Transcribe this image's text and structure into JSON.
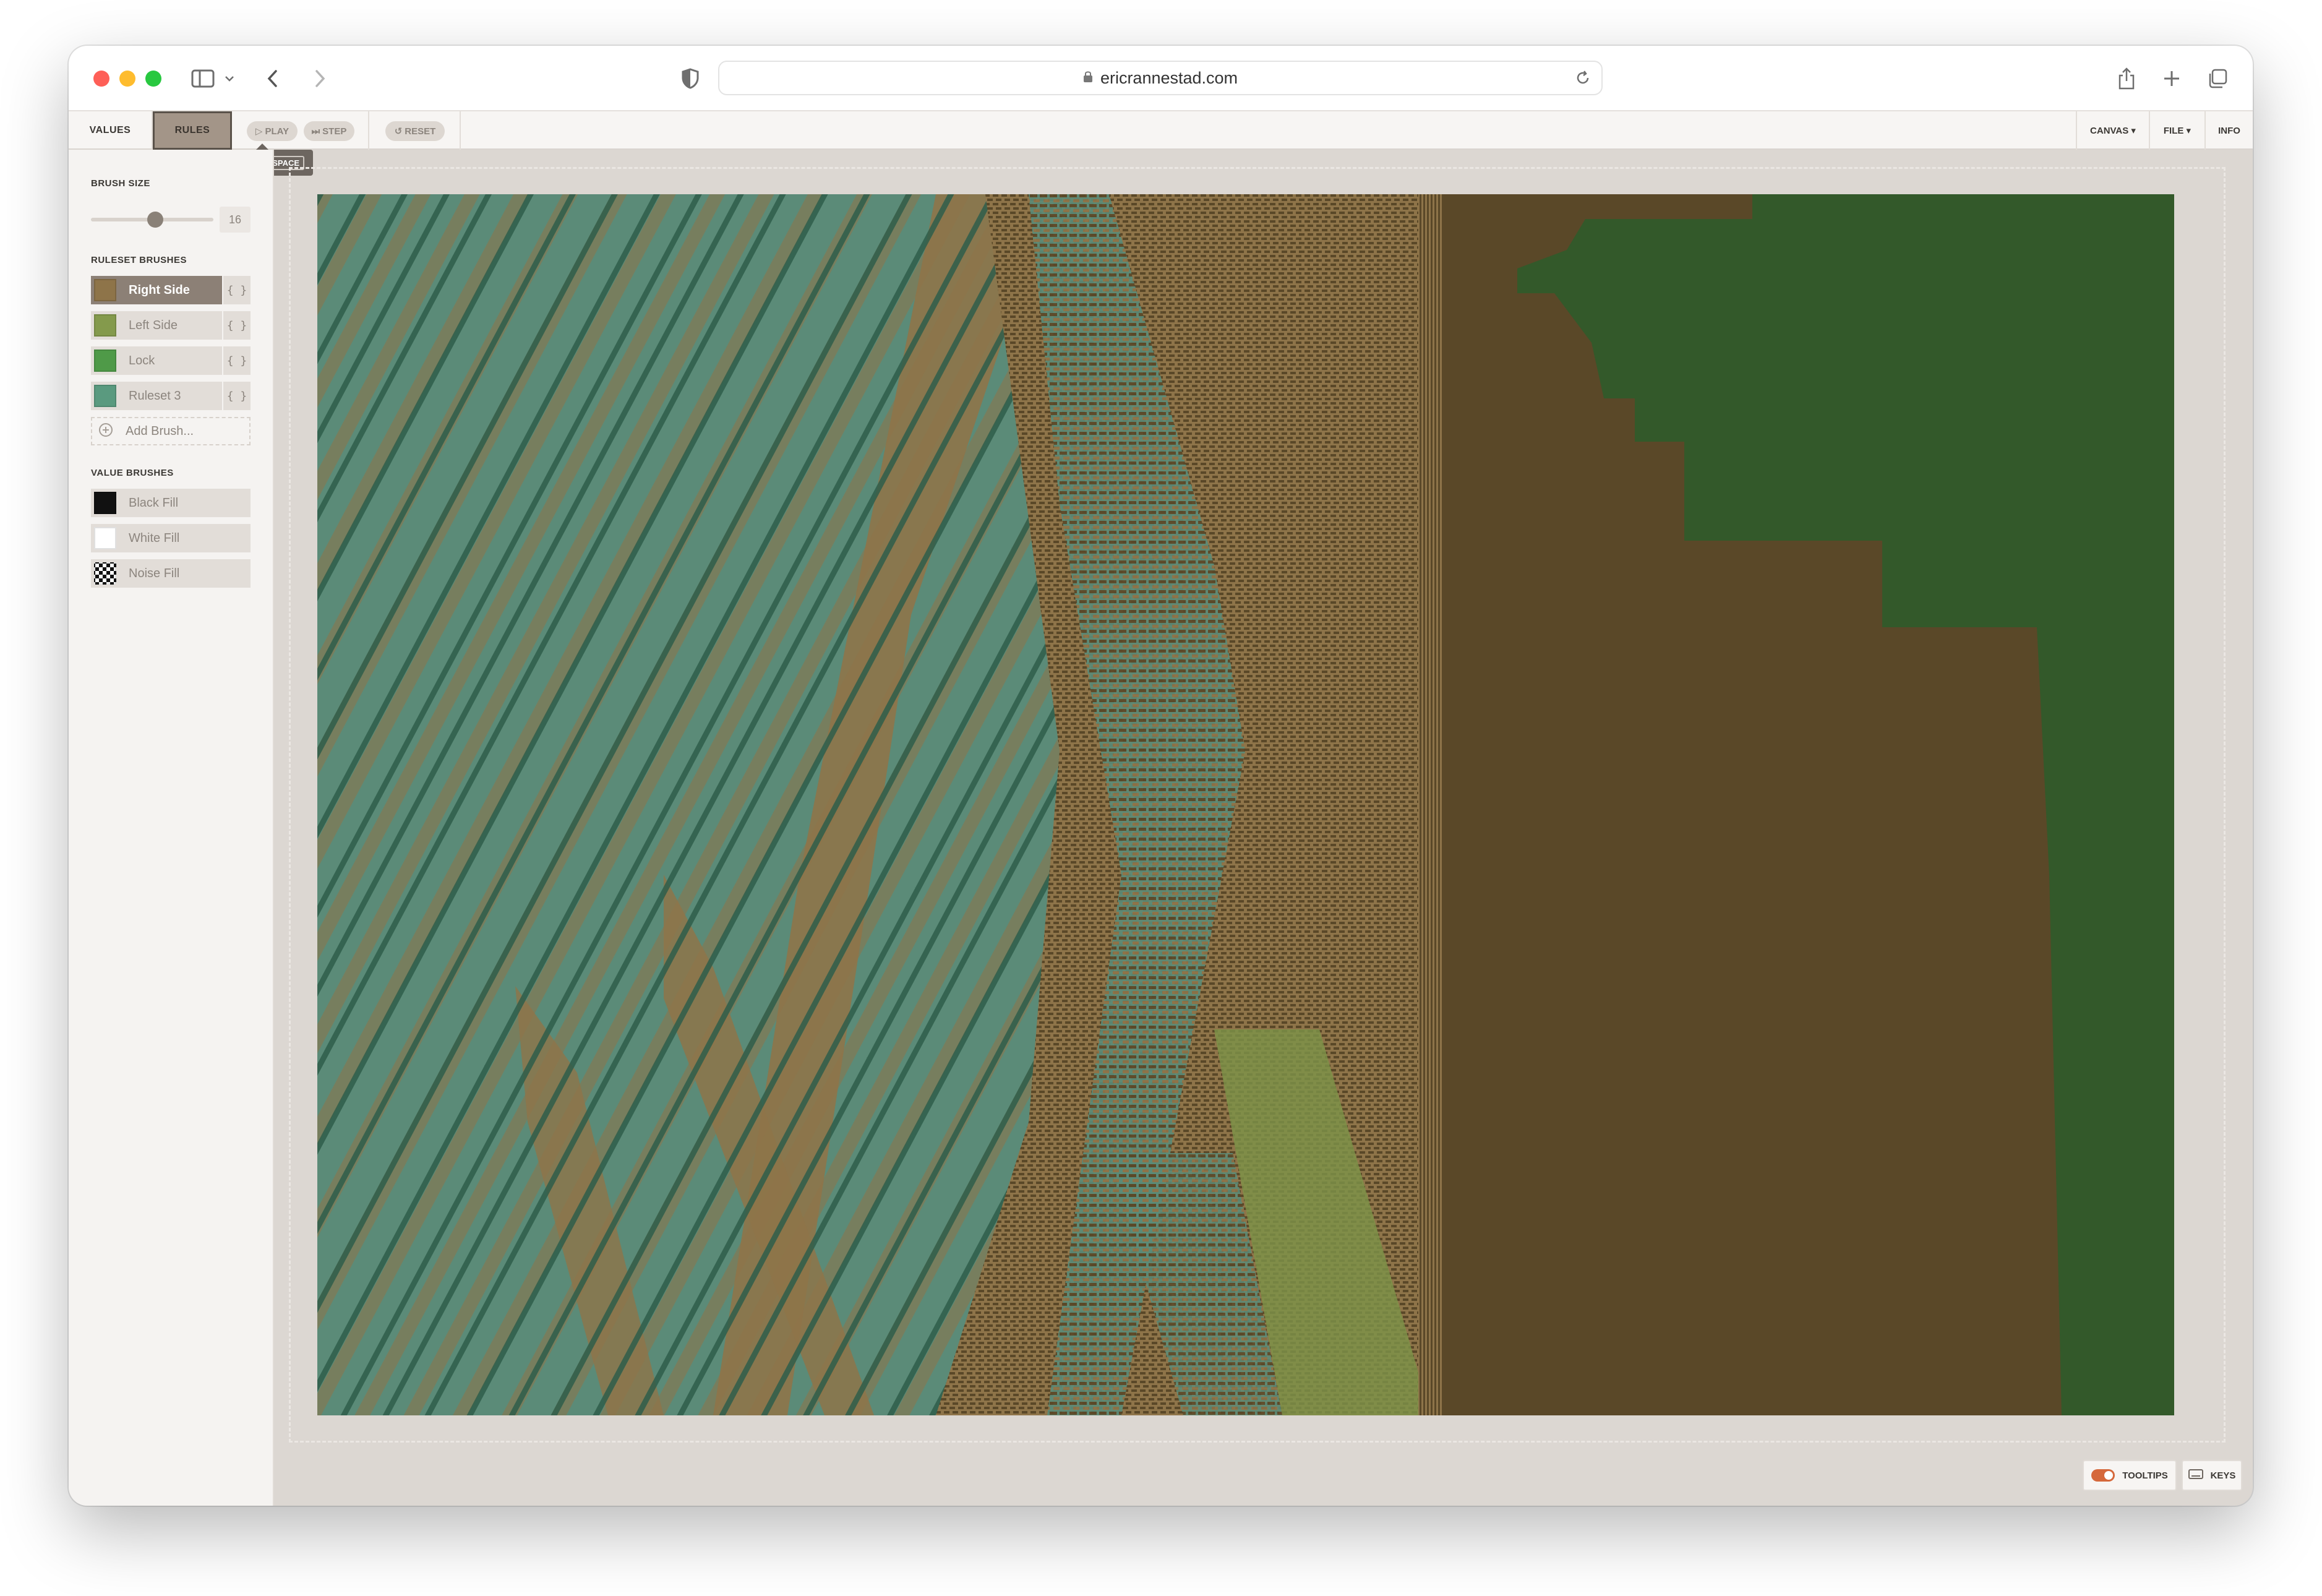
{
  "browser": {
    "url": "ericrannestad.com"
  },
  "toolbar": {
    "tabs": [
      {
        "label": "VALUES",
        "active": false
      },
      {
        "label": "RULES",
        "active": true
      }
    ],
    "play_label": "PLAY",
    "step_label": "STEP",
    "reset_label": "RESET",
    "canvas_menu": "CANVAS ▾",
    "file_menu": "FILE ▾",
    "info_label": "INFO",
    "tooltip_key": "SPACE"
  },
  "sidebar": {
    "brush_size_title": "BRUSH SIZE",
    "brush_size_value": "16",
    "brush_size_level": 0.5,
    "ruleset_title": "RULESET BRUSHES",
    "ruleset_brushes": [
      {
        "label": "Right Side",
        "code": "{ }",
        "color": "#8e7449",
        "selected": true
      },
      {
        "label": "Left Side",
        "code": "{ }",
        "color": "#849a4c",
        "selected": false
      },
      {
        "label": "Lock",
        "code": "{ }",
        "color": "#4f9a48",
        "selected": false
      },
      {
        "label": "Ruleset 3",
        "code": "{ }",
        "color": "#5a9a7f",
        "selected": false
      }
    ],
    "add_brush_label": "Add Brush...",
    "value_title": "VALUE BRUSHES",
    "value_brushes": [
      {
        "label": "Black Fill",
        "color": "#111111"
      },
      {
        "label": "White Fill",
        "color": "#ffffff"
      },
      {
        "label": "Noise Fill",
        "color": "noise"
      }
    ]
  },
  "footer": {
    "tooltips_label": "TOOLTIPS",
    "keys_label": "KEYS",
    "tooltips_on": true
  },
  "colors": {
    "accent": "#d5683b",
    "canvas_teal": "#5b8b78",
    "canvas_tan": "#8e7449",
    "canvas_brown": "#5a4828",
    "canvas_dark_green": "#33592a",
    "canvas_dark_teal": "#2e5d4a",
    "canvas_olive": "#7d9448"
  }
}
